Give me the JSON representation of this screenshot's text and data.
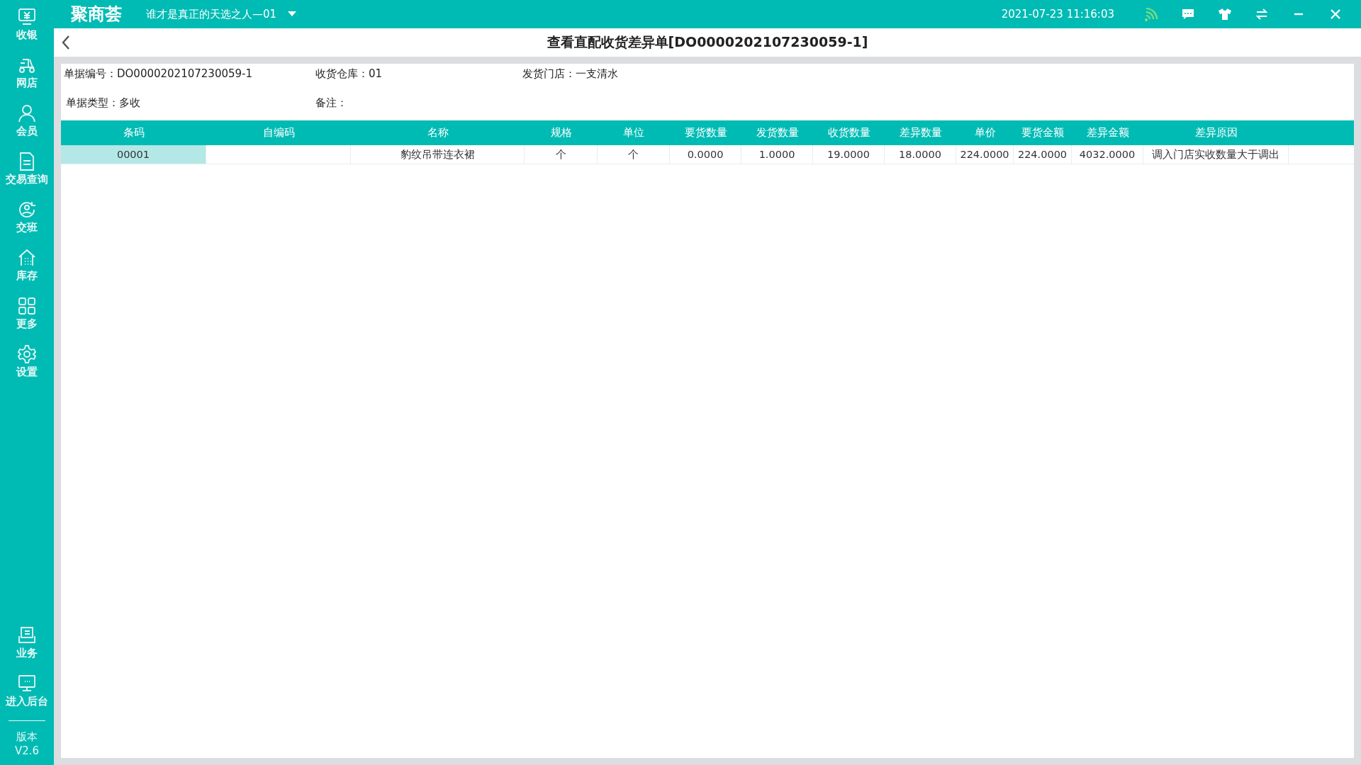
{
  "sidebar": {
    "items": [
      {
        "kind": "cashier",
        "label": "收银"
      },
      {
        "kind": "scooter",
        "label": "网店"
      },
      {
        "kind": "person",
        "label": "会员"
      },
      {
        "kind": "document",
        "label": "交易查询"
      },
      {
        "kind": "shift",
        "label": "交班"
      },
      {
        "kind": "house",
        "label": "库存"
      },
      {
        "kind": "grid",
        "label": "更多"
      },
      {
        "kind": "gear",
        "label": "设置"
      }
    ],
    "bottom_items": [
      {
        "kind": "tray",
        "label": "业务"
      },
      {
        "kind": "monitor",
        "label": "进入后台"
      }
    ],
    "version_label": "版本",
    "version": "V2.6"
  },
  "top_bar": {
    "logo": "聚商荟",
    "store": "谁才是真正的天选之人—01",
    "datetime": "2021-07-23 11:16:03"
  },
  "page": {
    "title": "查看直配收货差异单[DO0000202107230059-1]"
  },
  "info": [
    {
      "label": "单据编号：",
      "value": "DO0000202107230059-1"
    },
    {
      "label": "收货仓库：",
      "value": "01"
    },
    {
      "label": "发货门店：",
      "value": "一支清水"
    },
    {
      "label": "单据类型：",
      "value": "多收"
    },
    {
      "label": "备注："
    }
  ],
  "table": {
    "columns": [
      "条码",
      "自编码",
      "名称",
      "规格",
      "单位",
      "要货数量",
      "发货数量",
      "收货数量",
      "差异数量",
      "单价",
      "要货金额",
      "差异金额",
      "差异原因"
    ],
    "rows": [
      {
        "cells": [
          {
            "text": "00001",
            "selected": true
          },
          {
            "selected": false
          },
          {
            "text": "豹纹吊带连衣裙",
            "selected": false
          },
          {
            "text": "个",
            "selected": false
          },
          {
            "text": "个",
            "selected": false
          },
          {
            "text": "0.0000",
            "selected": false
          },
          {
            "text": "1.0000",
            "selected": false
          },
          {
            "text": "19.0000",
            "selected": false
          },
          {
            "text": "18.0000",
            "selected": false
          },
          {
            "text": "224.0000",
            "selected": false
          },
          {
            "text": "224.0000",
            "selected": false
          },
          {
            "text": "4032.0000",
            "selected": false
          },
          {
            "text": "调入门店实收数量大于调出",
            "selected": false
          }
        ]
      }
    ]
  }
}
